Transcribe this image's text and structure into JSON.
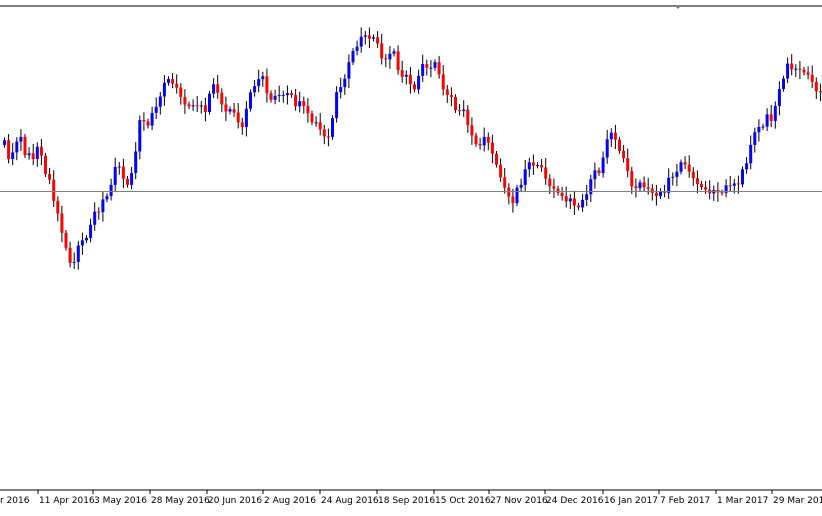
{
  "colors": {
    "background": "#ffffff",
    "up": "#0000ff",
    "down": "#ff0000",
    "wick": "#000000",
    "reference_line": "#808080",
    "axis": "#000000"
  },
  "chart_data": {
    "type": "candlestick",
    "x_ticks": [
      "r 2016",
      "11 Apr 2016",
      "3 May 2016",
      "28 May 2016",
      "20 Jun 2016",
      "2 Aug 2016",
      "24 Aug 2016",
      "18 Sep 2016",
      "15 Oct 2016",
      "27 Nov 2016",
      "24 Dec 2016",
      "16 Jan 2017",
      "7 Feb 2017",
      "1 Mar 2017",
      "29 Mar 2017"
    ],
    "ylim": [
      0,
      100
    ],
    "reference_level": 61.5,
    "grid": false,
    "candle_count": 200,
    "closes": [
      72.3,
      68.3,
      69.7,
      72.0,
      73.0,
      69.1,
      69.5,
      68.3,
      70.9,
      69.0,
      65.1,
      63.9,
      59.4,
      56.7,
      52.6,
      49.4,
      46.2,
      46.4,
      49.9,
      51.0,
      51.5,
      54.3,
      57.1,
      57.0,
      59.7,
      60.4,
      62.8,
      66.6,
      66.7,
      64.1,
      62.8,
      65.3,
      69.9,
      76.6,
      76.3,
      75.4,
      78.1,
      79.4,
      81.6,
      84.5,
      85.3,
      84.3,
      83.5,
      81.5,
      79.9,
      79.5,
      79.7,
      79.6,
      79.7,
      78.3,
      82.2,
      84.2,
      82.4,
      79.9,
      78.4,
      78.9,
      78.2,
      76.1,
      75.1,
      79.0,
      82.5,
      83.8,
      85.3,
      85.9,
      82.3,
      80.9,
      81.7,
      81.9,
      81.9,
      82.3,
      81.9,
      79.5,
      80.6,
      79.6,
      78.0,
      76.1,
      76.1,
      74.6,
      73.1,
      73.0,
      77.0,
      82.5,
      83.6,
      85.4,
      88.9,
      91.3,
      92.2,
      94.3,
      94.6,
      93.9,
      94.2,
      92.9,
      89.7,
      89.5,
      90.7,
      91.2,
      87.2,
      85.8,
      86.2,
      84.2,
      83.1,
      86.0,
      88.5,
      87.7,
      87.7,
      88.9,
      86.3,
      83.1,
      81.9,
      81.5,
      78.7,
      78.5,
      78.8,
      75.5,
      73.3,
      71.5,
      71.2,
      73.0,
      71.8,
      69.4,
      67.1,
      64.4,
      62.2,
      60.3,
      58.9,
      62.2,
      62.8,
      66.1,
      67.6,
      66.9,
      67.0,
      66.5,
      64.1,
      62.5,
      62.0,
      61.1,
      60.4,
      59.3,
      59.9,
      58.4,
      58.0,
      59.6,
      60.8,
      64.0,
      65.9,
      65.3,
      68.6,
      72.5,
      73.9,
      72.4,
      70.0,
      68.5,
      65.7,
      62.5,
      62.1,
      63.3,
      62.3,
      62.0,
      61.1,
      60.4,
      61.5,
      61.1,
      64.3,
      64.5,
      65.6,
      67.6,
      67.1,
      65.6,
      64.2,
      63.0,
      62.3,
      61.8,
      61.0,
      61.7,
      61.2,
      61.1,
      62.7,
      62.6,
      63.1,
      62.9,
      66.1,
      67.4,
      71.3,
      74.0,
      75.1,
      75.2,
      77.8,
      76.4,
      79.6,
      83.2,
      85.4,
      88.6,
      87.4,
      87.5,
      87.3,
      86.7,
      86.2,
      84.7,
      82.7,
      82.6
    ]
  }
}
